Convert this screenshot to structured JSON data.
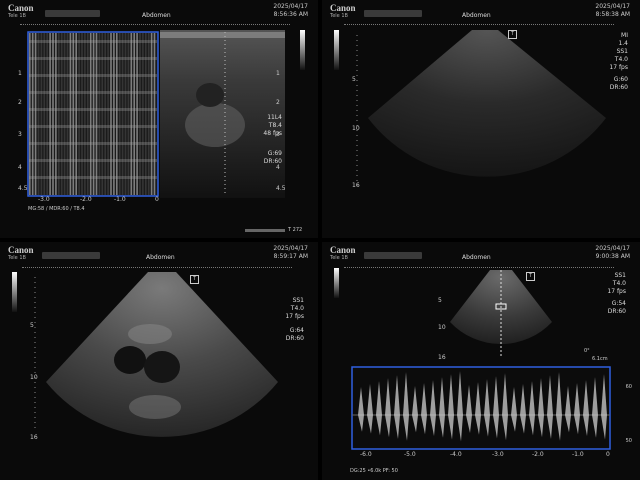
{
  "brand": "Canon",
  "study": "Abdomen",
  "panels": {
    "tl": {
      "date": "2025/04/17",
      "time": "8:56:36 AM",
      "params": [
        "11L4",
        "T8.4",
        "48 fps",
        "G:69",
        "DR:60"
      ],
      "mmode_depth_ticks": [
        "1",
        "2",
        "3",
        "4",
        "4.5"
      ],
      "mmode_time_ticks": [
        "-3.0",
        "-2.0",
        "-1.0",
        "0"
      ],
      "bmode_depth_ticks": [
        "1",
        "2",
        "3",
        "4",
        "4.5"
      ],
      "footer_left": "MG:58  / MDR:60 / T8.4",
      "footer_right": "272"
    },
    "tr": {
      "date": "2025/04/17",
      "time": "8:58:38 AM",
      "params": [
        "MI",
        "1.4",
        "SS1",
        "T4.0",
        "17 fps",
        "G:60",
        "DR:60"
      ],
      "depth_ticks": [
        "5",
        "10",
        "16"
      ]
    },
    "bl": {
      "date": "2025/04/17",
      "time": "8:59:17 AM",
      "params": [
        "SS1",
        "T4.0",
        "17 fps",
        "G:64",
        "DR:60"
      ],
      "depth_ticks": [
        "5",
        "10",
        "16"
      ]
    },
    "br": {
      "date": "2025/04/17",
      "time": "9:00:38 AM",
      "params": [
        "SS1",
        "T4.0",
        "17 fps",
        "G:54",
        "DR:60"
      ],
      "depth_ticks": [
        "5",
        "10",
        "16"
      ],
      "angle": "0°",
      "gate": "6.1cm",
      "doppler_time_ticks": [
        "-6.0",
        "-5.0",
        "-4.0",
        "-3.0",
        "-2.0",
        "-1.0",
        "0"
      ],
      "doppler_right_ticks": [
        "60",
        "50"
      ],
      "footer_left": "DG:25  •6.0k  PF: 50"
    }
  },
  "colors": {
    "frame_blue": "#2f5fe0",
    "background": "#0a0a0a"
  }
}
